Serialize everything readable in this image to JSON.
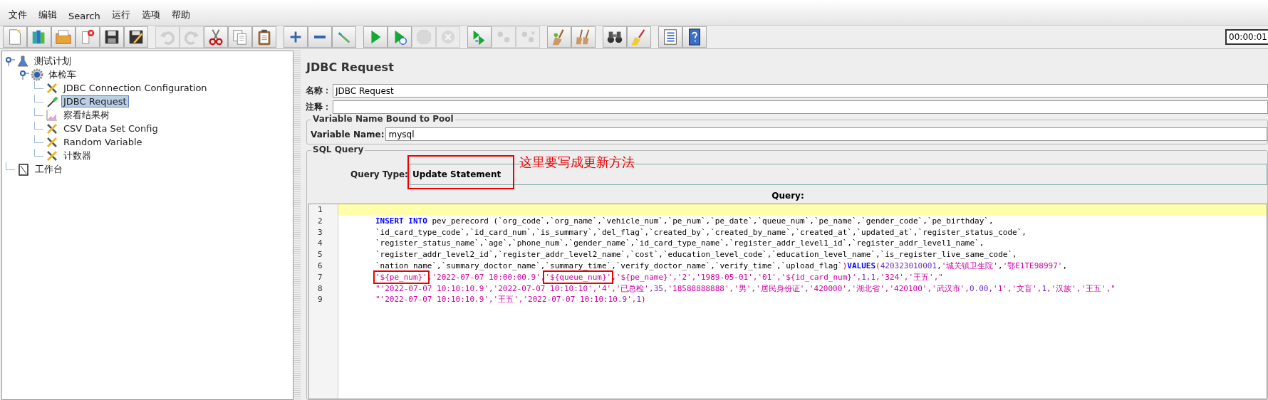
{
  "menu": [
    "文件",
    "编辑",
    "Search",
    "运行",
    "选项",
    "帮助"
  ],
  "toolbar": [
    [
      {
        "kind": "new",
        "disabled": false
      },
      {
        "kind": "templates",
        "disabled": false
      },
      {
        "kind": "open",
        "disabled": false
      },
      {
        "kind": "close",
        "disabled": false
      },
      {
        "kind": "save",
        "disabled": false
      },
      {
        "kind": "save-as",
        "disabled": false
      }
    ],
    [
      {
        "kind": "undo",
        "disabled": true
      },
      {
        "kind": "redo",
        "disabled": true
      },
      {
        "kind": "cut",
        "disabled": false
      },
      {
        "kind": "copy",
        "disabled": false
      },
      {
        "kind": "paste",
        "disabled": false
      }
    ],
    [
      {
        "kind": "expand",
        "disabled": false
      },
      {
        "kind": "collapse",
        "disabled": false
      },
      {
        "kind": "toggle",
        "disabled": false
      }
    ],
    [
      {
        "kind": "start",
        "disabled": false
      },
      {
        "kind": "start-no-timers",
        "disabled": false
      },
      {
        "kind": "stop",
        "disabled": true
      },
      {
        "kind": "shutdown",
        "disabled": true
      }
    ],
    [
      {
        "kind": "remote-start",
        "disabled": false
      },
      {
        "kind": "remote-stop",
        "disabled": true
      },
      {
        "kind": "remote-exit",
        "disabled": true
      }
    ],
    [
      {
        "kind": "clear",
        "disabled": false
      },
      {
        "kind": "clear-all",
        "disabled": false
      }
    ],
    [
      {
        "kind": "search",
        "disabled": false
      },
      {
        "kind": "reset-search",
        "disabled": false
      }
    ],
    [
      {
        "kind": "function-helper",
        "disabled": false
      },
      {
        "kind": "help",
        "disabled": false
      }
    ]
  ],
  "timer": "00:00:01",
  "tree": [
    {
      "label": "测试计划",
      "kind": "plan",
      "expanded": true,
      "selected": false,
      "children": [
        {
          "label": "体检车",
          "kind": "thread-group",
          "expanded": true,
          "selected": false,
          "children": [
            {
              "label": "JDBC Connection Configuration",
              "kind": "config",
              "selected": false
            },
            {
              "label": "JDBC Request",
              "kind": "sampler",
              "selected": true
            },
            {
              "label": "察看结果树",
              "kind": "listener",
              "selected": false
            },
            {
              "label": "CSV Data Set Config",
              "kind": "config",
              "selected": false
            },
            {
              "label": "Random Variable",
              "kind": "config",
              "selected": false
            },
            {
              "label": "计数器",
              "kind": "config",
              "selected": false
            }
          ]
        }
      ]
    },
    {
      "label": "工作台",
      "kind": "workbench",
      "selected": false
    }
  ],
  "panel_title": "JDBC Request",
  "name_field": {
    "label": "名称：",
    "value": "JDBC Request"
  },
  "comment_field": {
    "label": "注释："
  },
  "pool_group": {
    "legend": "Variable Name Bound to Pool",
    "label": "Variable Name:",
    "value": "mysql"
  },
  "sql_group": {
    "legend": "SQL Query",
    "query_type": {
      "label": "Query Type:",
      "value": "Update Statement",
      "boxed": true
    },
    "annotation": "这里要写成更新方法",
    "query_label": "Query:"
  },
  "code_lines": [
    {
      "number": "1",
      "current": true
    },
    {
      "number": "2",
      "current": false,
      "tokens": [
        {
          "kind": "keyword",
          "text": "INSERT INTO"
        },
        {
          "kind": "plain",
          "text": " pev_perecord (`org_code`,`org_name`,`vehicle_num`,`pe_num`,`pe_date`,`queue_num`,`pe_name`,`gender_code`,`pe_birthday`,"
        }
      ]
    },
    {
      "number": "3",
      "current": false,
      "tokens": [
        {
          "kind": "plain",
          "text": "`id_card_type_code`,`id_card_num`,`is_summary`,`del_flag`,`created_by`,`created_by_name`,`created_at`,`updated_at`,`register_status_code`,"
        }
      ]
    },
    {
      "number": "4",
      "current": false,
      "tokens": [
        {
          "kind": "plain",
          "text": "`register_status_name`,`age`,`phone_num`,`gender_name`,`id_card_type_name`,`register_addr_level1_id`,`register_addr_level1_name`,"
        }
      ]
    },
    {
      "number": "5",
      "current": false,
      "tokens": [
        {
          "kind": "plain",
          "text": "`register_addr_level2_id`,`register_addr_level2_name`,`cost`,`education_level_code`,`education_level_name`,`is_register_live_same_code`,"
        }
      ]
    },
    {
      "number": "6",
      "current": false,
      "tokens": [
        {
          "kind": "plain",
          "text": "`nation name`,`summary_doctor_name`,`summary_time`,`verify_doctor_name`,`verify_time`,`upload_flag`"
        },
        {
          "kind": "operator",
          "text": ")"
        },
        {
          "kind": "keyword",
          "text": "VALUES"
        },
        {
          "kind": "operator",
          "text": "("
        },
        {
          "kind": "number",
          "text": "420323010001"
        },
        {
          "kind": "plain",
          "text": ","
        },
        {
          "kind": "string",
          "text": "'城关镇卫生院'"
        },
        {
          "kind": "plain",
          "text": ","
        },
        {
          "kind": "string",
          "text": "'鄂E1TE98997'"
        },
        {
          "kind": "plain",
          "text": ","
        }
      ]
    },
    {
      "number": "7",
      "current": false,
      "tokens": [
        {
          "kind": "string",
          "text": "'${pe_num}'",
          "boxed": true
        },
        {
          "kind": "string",
          "text": ",'2022-07-07 10:00:00.9',"
        },
        {
          "kind": "string",
          "text": "'${queue_num}'",
          "boxed": true
        },
        {
          "kind": "string",
          "text": ",'${pe_name}','2','1989-05-01','01','${id_card_num}',"
        },
        {
          "kind": "number",
          "text": "1,1"
        },
        {
          "kind": "string",
          "text": ",'324','王五',\""
        }
      ]
    },
    {
      "number": "8",
      "current": false,
      "tokens": [
        {
          "kind": "string",
          "text": "\"'2022-07-07 10:10:10.9','2022-07-07 10:10:10','4','已总检',"
        },
        {
          "kind": "number",
          "text": "35"
        },
        {
          "kind": "string",
          "text": ",'18588888888','男','居民身份证','420000','湖北省','420100','武汉市',"
        },
        {
          "kind": "number",
          "text": "0.00"
        },
        {
          "kind": "string",
          "text": ",'1','文盲',"
        },
        {
          "kind": "number",
          "text": "1"
        },
        {
          "kind": "string",
          "text": ",'汉族','王五',\""
        }
      ]
    },
    {
      "number": "9",
      "current": false,
      "tokens": [
        {
          "kind": "string",
          "text": "\"'2022-07-07 10:10:10.9','王五','2022-07-07 10:10:10.9',"
        },
        {
          "kind": "number",
          "text": "1"
        },
        {
          "kind": "operator",
          "text": ")"
        }
      ]
    }
  ]
}
